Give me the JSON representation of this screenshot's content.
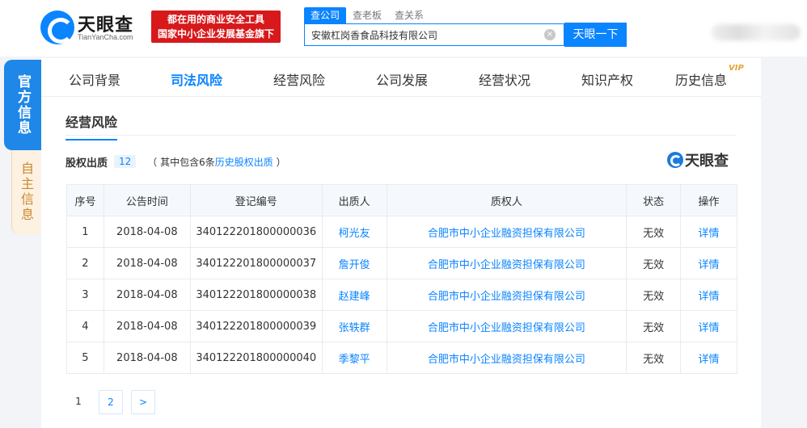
{
  "header": {
    "logo_cn": "天眼查",
    "logo_en": "TianYanCha.com",
    "slogan_line1": "都在用的商业安全工具",
    "slogan_line2": "国家中小企业发展基金旗下",
    "search_tabs": [
      "查公司",
      "查老板",
      "查关系"
    ],
    "search_value": "安徽杠岗香食品科技有限公司",
    "search_button": "天眼一下",
    "clear_icon": "×"
  },
  "side": {
    "official": "官方信息",
    "self": "自主信息"
  },
  "nav": {
    "items": [
      "公司背景",
      "司法风险",
      "经营风险",
      "公司发展",
      "经营状况",
      "知识产权",
      "历史信息"
    ],
    "active": "司法风险",
    "vip": "VIP"
  },
  "section": {
    "title": "经营风险",
    "sub_title": "股权出质",
    "count": "12",
    "note_prefix": "（ 其中包含6条",
    "note_link": "历史股权出质",
    "note_suffix": " ）",
    "watermark": "天眼查"
  },
  "table": {
    "headers": [
      "序号",
      "公告时间",
      "登记编号",
      "出质人",
      "质权人",
      "状态",
      "操作"
    ],
    "rows": [
      [
        "1",
        "2018-04-08",
        "340122201800000036",
        "柯光友",
        "合肥市中小企业融资担保有限公司",
        "无效",
        "详情"
      ],
      [
        "2",
        "2018-04-08",
        "340122201800000037",
        "詹开俊",
        "合肥市中小企业融资担保有限公司",
        "无效",
        "详情"
      ],
      [
        "3",
        "2018-04-08",
        "340122201800000038",
        "赵建峰",
        "合肥市中小企业融资担保有限公司",
        "无效",
        "详情"
      ],
      [
        "4",
        "2018-04-08",
        "340122201800000039",
        "张轶群",
        "合肥市中小企业融资担保有限公司",
        "无效",
        "详情"
      ],
      [
        "5",
        "2018-04-08",
        "340122201800000040",
        "季黎平",
        "合肥市中小企业融资担保有限公司",
        "无效",
        "详情"
      ]
    ]
  },
  "pagination": {
    "current": "1",
    "next_page": "2",
    "next": ">"
  },
  "colors": {
    "accent": "#0a84ff",
    "slogan_bg": "#d7191c",
    "side_official": "#1f87e8",
    "side_self": "#fdf1e1"
  }
}
